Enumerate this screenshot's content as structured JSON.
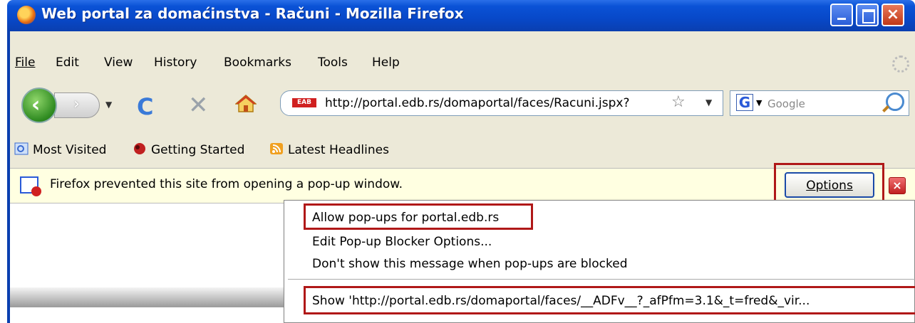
{
  "window": {
    "title": "Web portal za domaćinstva - Računi - Mozilla Firefox",
    "controls": {
      "minimize": "minimize-icon",
      "maximize": "maximize-icon",
      "close": "×"
    }
  },
  "menu": [
    "File",
    "Edit",
    "View",
    "History",
    "Bookmarks",
    "Tools",
    "Help"
  ],
  "navbar": {
    "back_glyph": "‹",
    "forward_glyph": "›",
    "url": "http://portal.edb.rs/domaportal/faces/Racuni.jspx?",
    "favicon_text": "EAB",
    "search_engine_glyph": "G",
    "search_placeholder": "Google"
  },
  "bookmarks": [
    "Most Visited",
    "Getting Started",
    "Latest Headlines"
  ],
  "notification": {
    "text": "Firefox prevented this site from opening a pop-up window.",
    "options_label": "Options",
    "close_glyph": "×"
  },
  "popup_menu": [
    "Allow pop-ups for portal.edb.rs",
    "Edit Pop-up Blocker Options...",
    "Don't show this message when pop-ups are blocked",
    "Show 'http://portal.edb.rs/domaportal/faces/__ADFv__?_afPfm=3.1&_t=fred&_vir..."
  ],
  "colors": {
    "titlebar": "#0848c8",
    "highlight_box": "#b01818",
    "notification_bg": "#ffffe1"
  }
}
